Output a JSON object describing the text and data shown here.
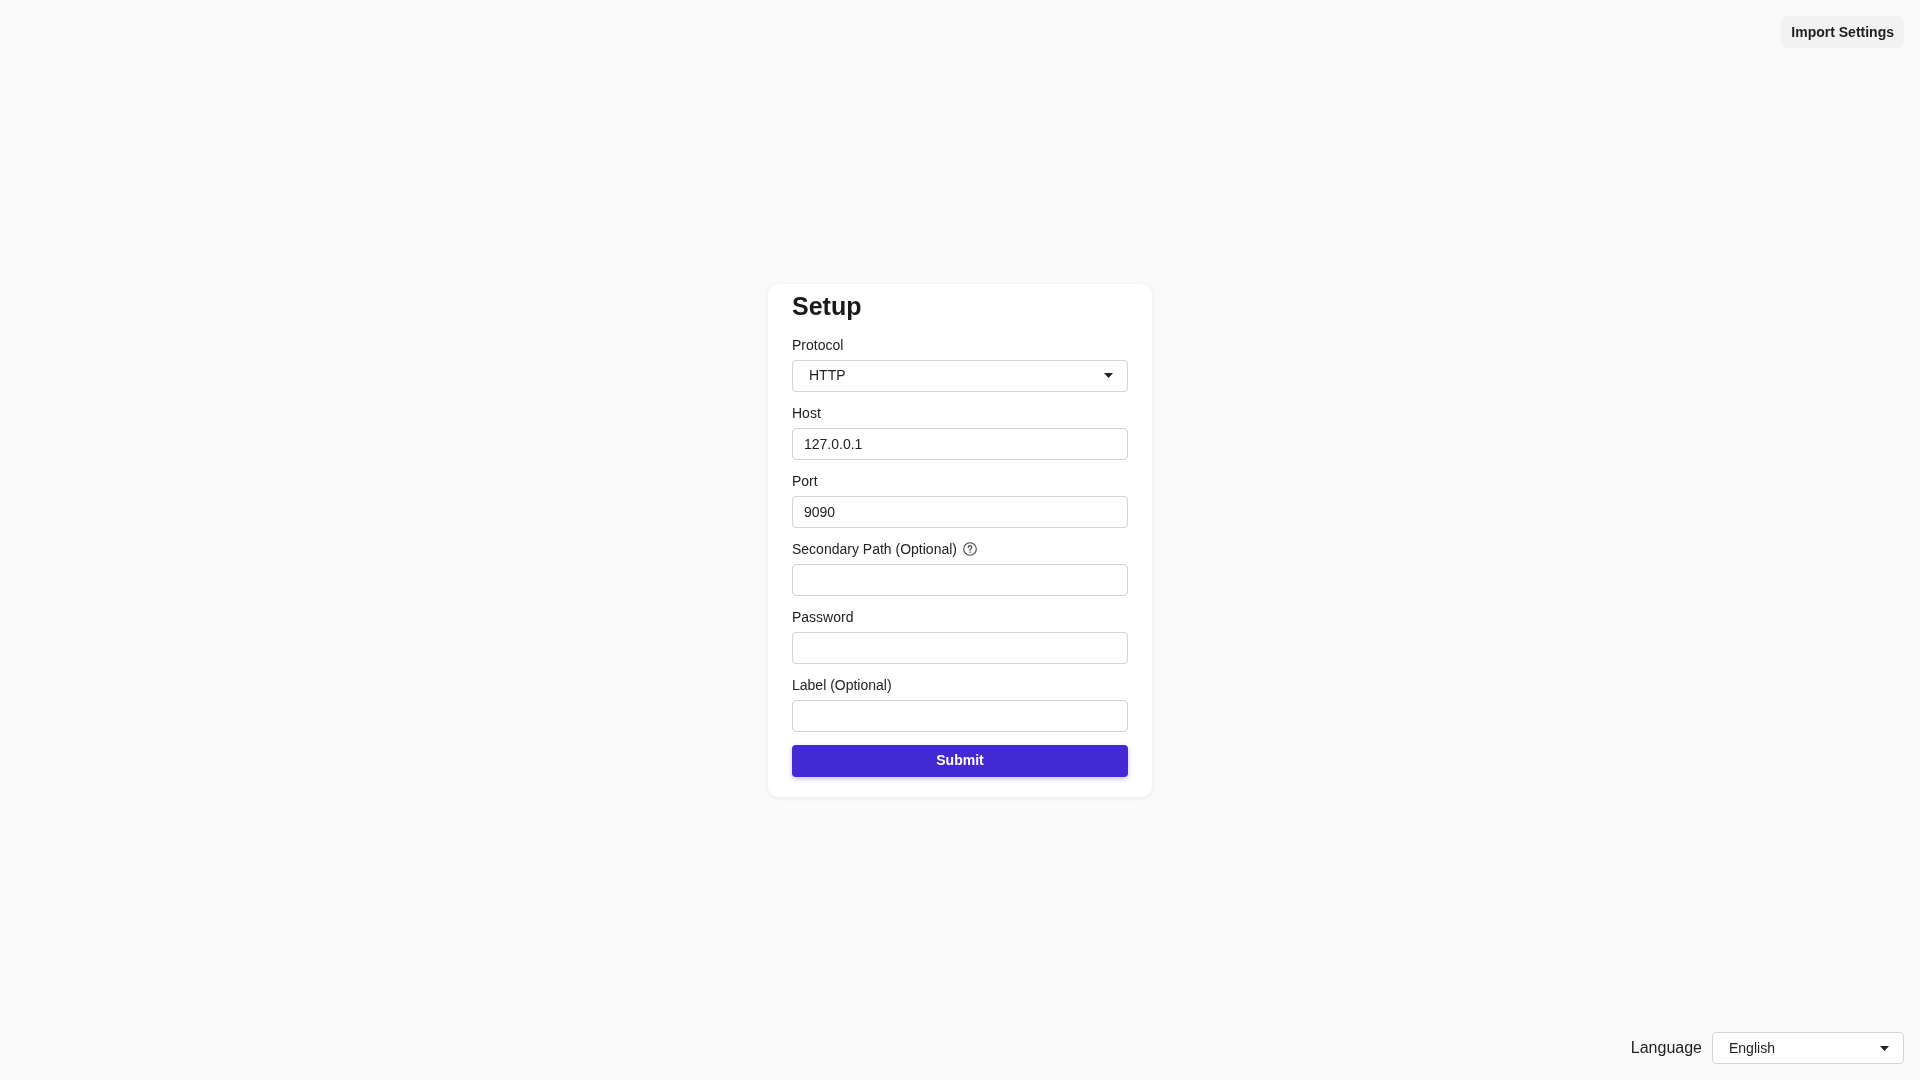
{
  "header": {
    "import_button": "Import Settings"
  },
  "form": {
    "title": "Setup",
    "fields": [
      {
        "kind": "select",
        "label": "Protocol",
        "value": "HTTP"
      },
      {
        "kind": "text",
        "label": "Host",
        "value": "127.0.0.1"
      },
      {
        "kind": "text",
        "label": "Port",
        "value": "9090"
      },
      {
        "kind": "text",
        "label": "Secondary Path (Optional)",
        "help": true
      },
      {
        "kind": "password",
        "label": "Password"
      },
      {
        "kind": "text",
        "label": "Label (Optional)"
      }
    ],
    "submit": "Submit"
  },
  "footer": {
    "language_label": "Language",
    "language_value": "English"
  }
}
